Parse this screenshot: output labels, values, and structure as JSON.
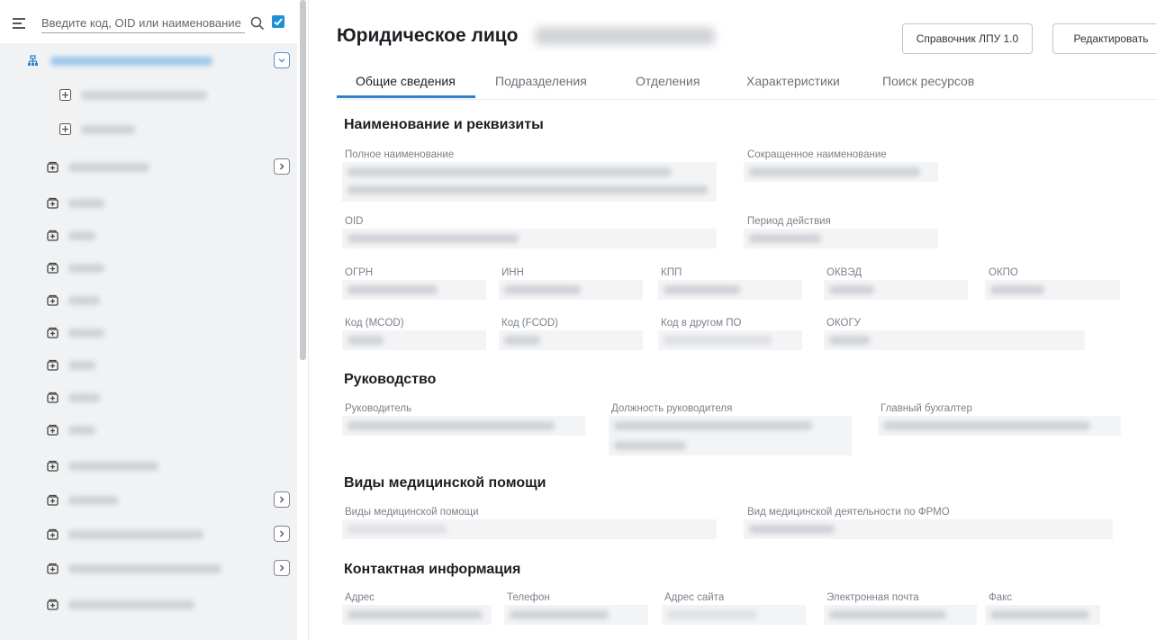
{
  "sidebar": {
    "search_placeholder": "Введите код, OID или наименование",
    "filter_checked": true
  },
  "main": {
    "title": "Юридическое лицо",
    "buttons": {
      "reference": "Справочник ЛПУ 1.0",
      "edit": "Редактировать"
    },
    "tabs": [
      "Общие сведения",
      "Подразделения",
      "Отделения",
      "Характеристики",
      "Поиск ресурсов"
    ],
    "active_tab": "Общие сведения",
    "sections": {
      "details": {
        "heading": "Наименование и реквизиты",
        "labels": {
          "full_name": "Полное наименование",
          "short_name": "Сокращенное наименование",
          "oid": "OID",
          "period": "Период действия",
          "ogrn": "ОГРН",
          "inn": "ИНН",
          "kpp": "КПП",
          "okved": "ОКВЭД",
          "okpo": "ОКПО",
          "mcod": "Код (MCOD)",
          "fcod": "Код (FCOD)",
          "other_code": "Код в другом ПО",
          "okogu": "ОКОГУ"
        }
      },
      "management": {
        "heading": "Руководство",
        "labels": {
          "head": "Руководитель",
          "position": "Должность руководителя",
          "accountant": "Главный бухгалтер"
        }
      },
      "care": {
        "heading": "Виды медицинской помощи",
        "labels": {
          "types": "Виды медицинской помощи",
          "frmo": "Вид медицинской деятельности по ФРМО"
        }
      },
      "contacts": {
        "heading": "Контактная информация",
        "labels": {
          "address": "Адрес",
          "phone": "Телефон",
          "site": "Адрес сайта",
          "email": "Электронная почта",
          "fax": "Факс"
        }
      }
    }
  },
  "colors": {
    "accent": "#2f80c8",
    "checkbox": "#1e8fd6"
  }
}
